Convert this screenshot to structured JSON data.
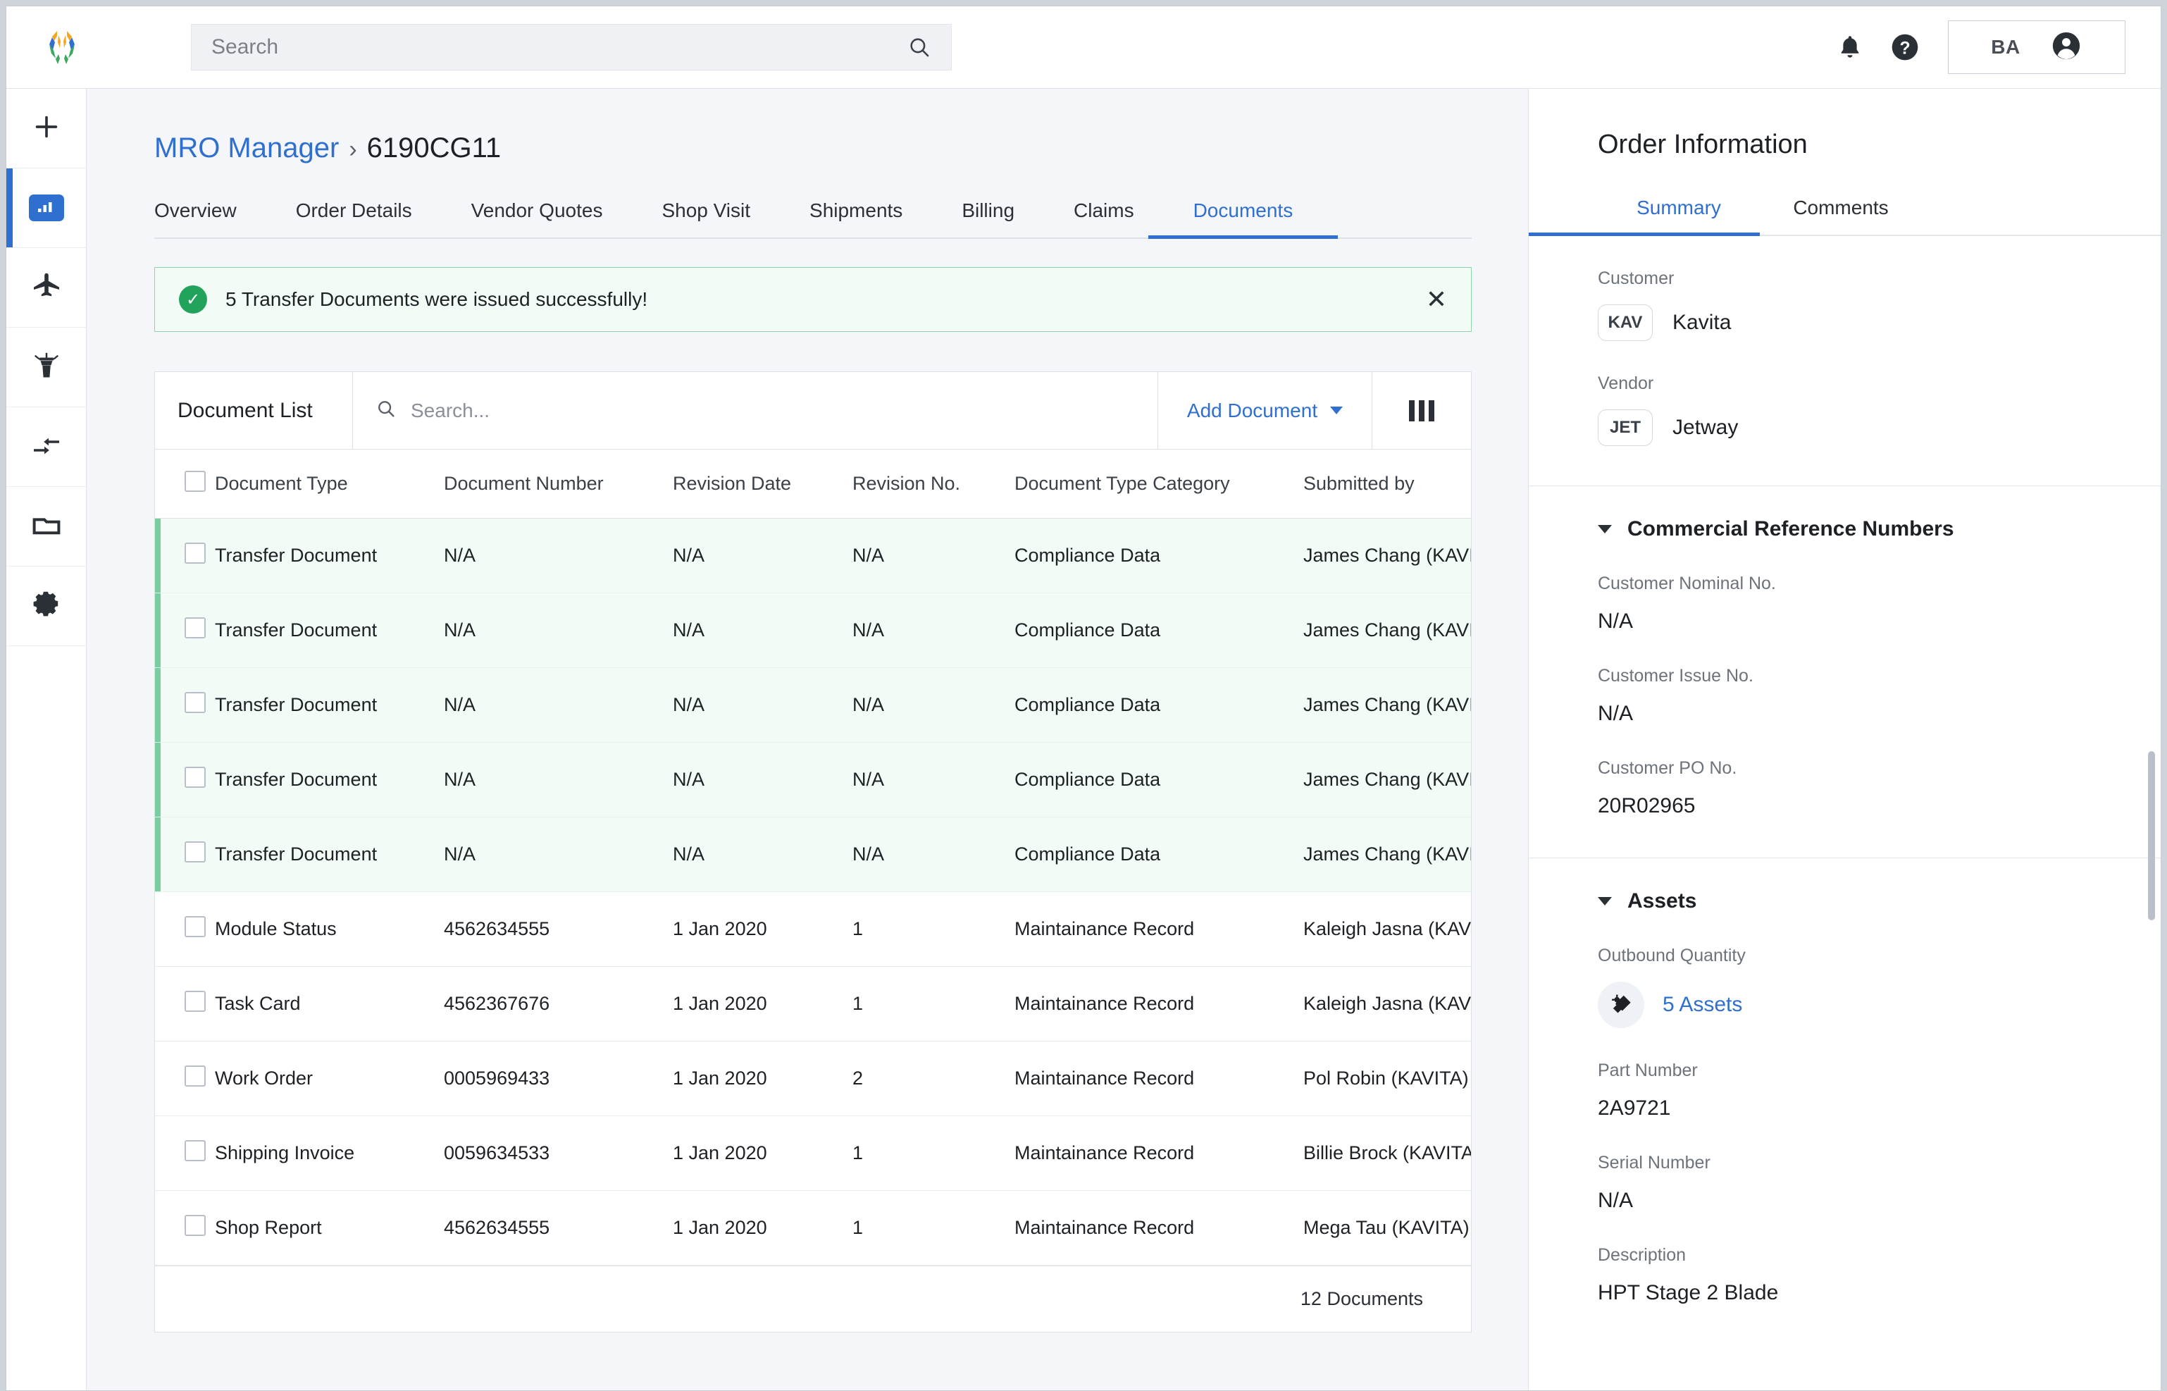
{
  "topbar": {
    "logo_name": "app-logo",
    "search": {
      "value": "",
      "placeholder": "Search"
    },
    "notifications_icon": "bell-icon",
    "help_icon": "question-circle-icon",
    "user_initials": "BA",
    "user_avatar_icon": "account-circle-icon"
  },
  "rail": {
    "items": [
      {
        "icon": "plus-icon",
        "name": "add",
        "active": false
      },
      {
        "icon": "dashboard-icon",
        "name": "dashboard",
        "active": true
      },
      {
        "icon": "airplane-icon",
        "name": "fleet",
        "active": false
      },
      {
        "icon": "control-tower-icon",
        "name": "operations",
        "active": false
      },
      {
        "icon": "transfer-arrows-icon",
        "name": "transfers",
        "active": false
      },
      {
        "icon": "folder-icon",
        "name": "documents",
        "active": false
      },
      {
        "icon": "gear-icon",
        "name": "settings",
        "active": false
      }
    ]
  },
  "breadcrumb": {
    "root": "MRO Manager",
    "separator": "›",
    "current": "6190CG11"
  },
  "tabs": [
    {
      "label": "Overview",
      "active": false
    },
    {
      "label": "Order Details",
      "active": false
    },
    {
      "label": "Vendor Quotes",
      "active": false
    },
    {
      "label": "Shop Visit",
      "active": false
    },
    {
      "label": "Shipments",
      "active": false
    },
    {
      "label": "Billing",
      "active": false
    },
    {
      "label": "Claims",
      "active": false
    },
    {
      "label": "Documents",
      "active": true
    }
  ],
  "alert": {
    "icon": "check-circle-icon",
    "message": "5 Transfer Documents were issued successfully!",
    "close_icon": "✕",
    "color": "#22a35b"
  },
  "card": {
    "title": "Document List",
    "search": {
      "value": "",
      "placeholder": "Search..."
    },
    "search_icon": "search-icon",
    "add_button": "Add Document",
    "columns_icon": "columns-icon",
    "footer_count": "12 Documents"
  },
  "table": {
    "headers": [
      "Document Type",
      "Document Number",
      "Revision Date",
      "Revision No.",
      "Document Type Category",
      "Submitted by"
    ],
    "rows": [
      {
        "type": "Transfer Document",
        "number": "N/A",
        "date": "N/A",
        "rev": "N/A",
        "category": "Compliance Data",
        "submitted": "James Chang (KAVITA)",
        "highlight": true
      },
      {
        "type": "Transfer Document",
        "number": "N/A",
        "date": "N/A",
        "rev": "N/A",
        "category": "Compliance Data",
        "submitted": "James Chang (KAVITA)",
        "highlight": true
      },
      {
        "type": "Transfer Document",
        "number": "N/A",
        "date": "N/A",
        "rev": "N/A",
        "category": "Compliance Data",
        "submitted": "James Chang (KAVITA)",
        "highlight": true
      },
      {
        "type": "Transfer Document",
        "number": "N/A",
        "date": "N/A",
        "rev": "N/A",
        "category": "Compliance Data",
        "submitted": "James Chang (KAVITA)",
        "highlight": true
      },
      {
        "type": "Transfer Document",
        "number": "N/A",
        "date": "N/A",
        "rev": "N/A",
        "category": "Compliance Data",
        "submitted": "James Chang (KAVITA)",
        "highlight": true
      },
      {
        "type": "Module Status",
        "number": "4562634555",
        "date": "1 Jan 2020",
        "rev": "1",
        "category": "Maintainance Record",
        "submitted": "Kaleigh Jasna (KAVITA)",
        "highlight": false
      },
      {
        "type": "Task Card",
        "number": "4562367676",
        "date": "1 Jan 2020",
        "rev": "1",
        "category": "Maintainance Record",
        "submitted": "Kaleigh Jasna (KAVITA)",
        "highlight": false
      },
      {
        "type": "Work Order",
        "number": "0005969433",
        "date": "1 Jan 2020",
        "rev": "2",
        "category": "Maintainance Record",
        "submitted": "Pol Robin (KAVITA)",
        "highlight": false
      },
      {
        "type": "Shipping Invoice",
        "number": "0059634533",
        "date": "1 Jan 2020",
        "rev": "1",
        "category": "Maintainance Record",
        "submitted": "Billie Brock (KAVITA)",
        "highlight": false
      },
      {
        "type": "Shop Report",
        "number": "4562634555",
        "date": "1 Jan 2020",
        "rev": "1",
        "category": "Maintainance Record",
        "submitted": "Mega Tau (KAVITA)",
        "highlight": false
      }
    ]
  },
  "right_panel": {
    "title": "Order Information",
    "tabs": [
      {
        "label": "Summary",
        "active": true
      },
      {
        "label": "Comments",
        "active": false
      }
    ],
    "customer": {
      "label": "Customer",
      "chip": "KAV",
      "name": "Kavita"
    },
    "vendor": {
      "label": "Vendor",
      "chip": "JET",
      "name": "Jetway"
    },
    "commercial": {
      "heading": "Commercial Reference Numbers",
      "fields": [
        {
          "label": "Customer Nominal No.",
          "value": "N/A"
        },
        {
          "label": "Customer Issue No.",
          "value": "N/A"
        },
        {
          "label": "Customer PO No.",
          "value": "20R02965"
        }
      ]
    },
    "assets": {
      "heading": "Assets",
      "quantity_label": "Outbound Quantity",
      "quantity_link": "5 Assets",
      "quantity_icon": "turbine-blade-icon",
      "fields": [
        {
          "label": "Part Number",
          "value": "2A9721"
        },
        {
          "label": "Serial Number",
          "value": "N/A"
        },
        {
          "label": "Description",
          "value": "HPT Stage 2 Blade"
        }
      ]
    }
  },
  "colors": {
    "accent": "#2f6fd0",
    "success": "#22a35b",
    "success_bg": "#f2fbf5",
    "row_highlight": "#f3fbf6",
    "row_accent": "#79ce9f"
  }
}
